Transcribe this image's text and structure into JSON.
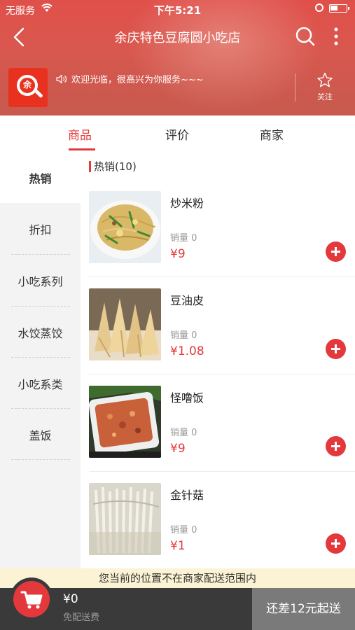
{
  "status_bar": {
    "carrier": "无服务",
    "time": "下午5:21"
  },
  "nav": {
    "title": "余庆特色豆腐圆小吃店"
  },
  "shop": {
    "logo_text": "余",
    "notice": "欢迎光临，很高兴为你服务~~~",
    "follow_label": "关注"
  },
  "tabs": [
    {
      "label": "商品",
      "active": true
    },
    {
      "label": "评价"
    },
    {
      "label": "商家"
    }
  ],
  "sidebar": {
    "items": [
      {
        "label": "热销",
        "active": true
      },
      {
        "label": "折扣"
      },
      {
        "label": "小吃系列"
      },
      {
        "label": "水饺蒸饺"
      },
      {
        "label": "小吃系类"
      },
      {
        "label": "盖饭"
      }
    ]
  },
  "category": {
    "title": "热销(10)"
  },
  "products": [
    {
      "name": "炒米粉",
      "sales": "销量 0",
      "price": "¥9"
    },
    {
      "name": "豆油皮",
      "sales": "销量 0",
      "price": "¥1.08"
    },
    {
      "name": "怪噜饭",
      "sales": "销量 0",
      "price": "¥9"
    },
    {
      "name": "金针菇",
      "sales": "销量 0",
      "price": "¥1"
    }
  ],
  "alert": "您当前的位置不在商家配送范围内",
  "cart": {
    "total": "¥0",
    "delivery": "免配送费",
    "minimum": "还差12元起送"
  },
  "colors": {
    "accent": "#e4393c",
    "header": "#d9574e",
    "bottom_bar": "#3a3a3a"
  }
}
